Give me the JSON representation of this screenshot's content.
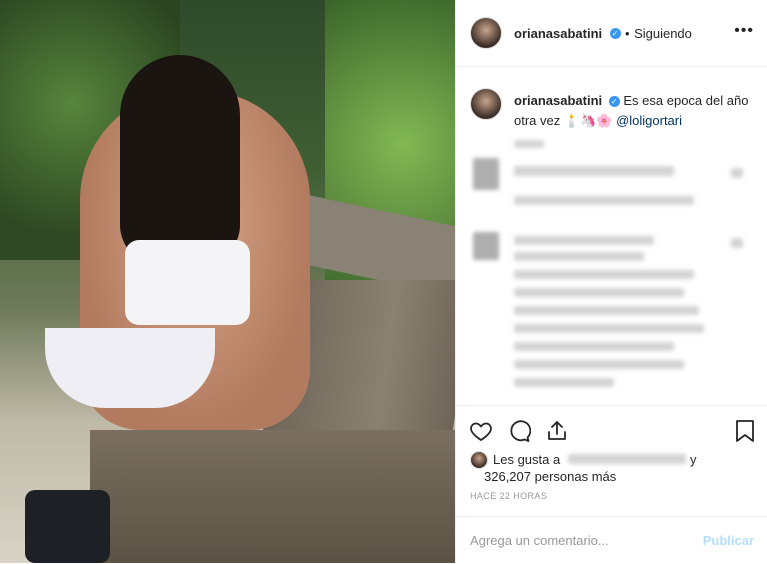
{
  "post": {
    "username": "orianasabatini",
    "following_label": "Siguiendo",
    "separator": "•",
    "caption_user": "orianasabatini",
    "caption_text": "Es esa epoca del año otra vez",
    "caption_emoji": "🕯️🦄🌸",
    "mention": "@loligortari",
    "likes_prefix": "Les gusta a",
    "likes_joiner": "y",
    "likes_count": "326,207 personas más",
    "timestamp": "HACE 22 HORAS",
    "comment_placeholder": "Agrega un comentario...",
    "publish_label": "Publicar",
    "more_glyph": "•••",
    "verified_glyph": "✓"
  },
  "colors": {
    "verified": "#3897f0",
    "mention": "#003569",
    "publish": "#b2dffc"
  }
}
